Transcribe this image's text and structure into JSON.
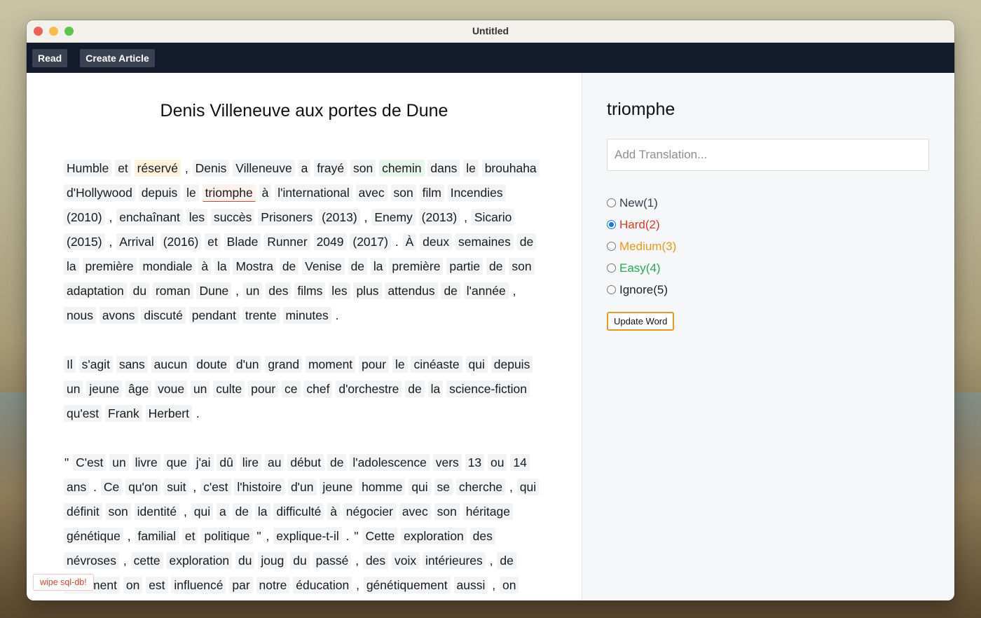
{
  "window": {
    "title": "Untitled"
  },
  "nav": {
    "read_label": "Read",
    "create_label": "Create Article"
  },
  "article": {
    "title": "Denis Villeneuve aux portes de Dune",
    "paragraphs": [
      [
        {
          "t": "Humble"
        },
        {
          "t": "et"
        },
        {
          "t": "réservé",
          "s": "medium"
        },
        {
          "t": ",",
          "p": true
        },
        {
          "t": "Denis"
        },
        {
          "t": "Villeneuve"
        },
        {
          "t": "a"
        },
        {
          "t": "frayé"
        },
        {
          "t": "son"
        },
        {
          "t": "chemin",
          "s": "easy"
        },
        {
          "t": "dans"
        },
        {
          "t": "le"
        },
        {
          "t": "brouhaha"
        },
        {
          "t": "d'Hollywood"
        },
        {
          "t": "depuis"
        },
        {
          "t": "le"
        },
        {
          "t": "triomphe",
          "s": "hard"
        },
        {
          "t": "à"
        },
        {
          "t": "l'international"
        },
        {
          "t": "avec"
        },
        {
          "t": "son"
        },
        {
          "t": "film"
        },
        {
          "t": "Incendies"
        },
        {
          "t": "(2010)"
        },
        {
          "t": ",",
          "p": true
        },
        {
          "t": "enchaînant"
        },
        {
          "t": "les"
        },
        {
          "t": "succès"
        },
        {
          "t": "Prisoners"
        },
        {
          "t": "(2013)"
        },
        {
          "t": ",",
          "p": true
        },
        {
          "t": "Enemy"
        },
        {
          "t": "(2013)"
        },
        {
          "t": ",",
          "p": true
        },
        {
          "t": "Sicario"
        },
        {
          "t": "(2015)"
        },
        {
          "t": ",",
          "p": true
        },
        {
          "t": "Arrival"
        },
        {
          "t": "(2016)"
        },
        {
          "t": "et"
        },
        {
          "t": "Blade"
        },
        {
          "t": "Runner"
        },
        {
          "t": "2049"
        },
        {
          "t": "(2017)"
        },
        {
          "t": ".",
          "p": true
        },
        {
          "t": "À"
        },
        {
          "t": "deux"
        },
        {
          "t": "semaines"
        },
        {
          "t": "de"
        },
        {
          "t": "la"
        },
        {
          "t": "première"
        },
        {
          "t": "mondiale"
        },
        {
          "t": "à"
        },
        {
          "t": "la"
        },
        {
          "t": "Mostra"
        },
        {
          "t": "de"
        },
        {
          "t": "Venise"
        },
        {
          "t": "de"
        },
        {
          "t": "la"
        },
        {
          "t": "première"
        },
        {
          "t": "partie"
        },
        {
          "t": "de"
        },
        {
          "t": "son"
        },
        {
          "t": "adaptation"
        },
        {
          "t": "du"
        },
        {
          "t": "roman"
        },
        {
          "t": "Dune"
        },
        {
          "t": ",",
          "p": true
        },
        {
          "t": "un"
        },
        {
          "t": "des"
        },
        {
          "t": "films"
        },
        {
          "t": "les"
        },
        {
          "t": "plus"
        },
        {
          "t": "attendus"
        },
        {
          "t": "de"
        },
        {
          "t": "l'année"
        },
        {
          "t": ",",
          "p": true
        },
        {
          "t": "nous"
        },
        {
          "t": "avons"
        },
        {
          "t": "discuté"
        },
        {
          "t": "pendant"
        },
        {
          "t": "trente"
        },
        {
          "t": "minutes"
        },
        {
          "t": ".",
          "p": true
        }
      ],
      [
        {
          "t": "Il"
        },
        {
          "t": "s'agit"
        },
        {
          "t": "sans"
        },
        {
          "t": "aucun"
        },
        {
          "t": "doute"
        },
        {
          "t": "d'un"
        },
        {
          "t": "grand"
        },
        {
          "t": "moment"
        },
        {
          "t": "pour"
        },
        {
          "t": "le"
        },
        {
          "t": "cinéaste"
        },
        {
          "t": "qui"
        },
        {
          "t": "depuis"
        },
        {
          "t": "un"
        },
        {
          "t": "jeune"
        },
        {
          "t": "âge"
        },
        {
          "t": "voue"
        },
        {
          "t": "un"
        },
        {
          "t": "culte"
        },
        {
          "t": "pour"
        },
        {
          "t": "ce"
        },
        {
          "t": "chef"
        },
        {
          "t": "d'orchestre"
        },
        {
          "t": "de"
        },
        {
          "t": "la"
        },
        {
          "t": "science-fiction"
        },
        {
          "t": "qu'est"
        },
        {
          "t": "Frank"
        },
        {
          "t": "Herbert"
        },
        {
          "t": ".",
          "p": true
        }
      ],
      [
        {
          "t": "\"",
          "p": true
        },
        {
          "t": "C'est"
        },
        {
          "t": "un"
        },
        {
          "t": "livre"
        },
        {
          "t": "que"
        },
        {
          "t": "j'ai"
        },
        {
          "t": "dû"
        },
        {
          "t": "lire"
        },
        {
          "t": "au"
        },
        {
          "t": "début"
        },
        {
          "t": "de"
        },
        {
          "t": "l'adolescence"
        },
        {
          "t": "vers"
        },
        {
          "t": "13"
        },
        {
          "t": "ou"
        },
        {
          "t": "14"
        },
        {
          "t": "ans"
        },
        {
          "t": ".",
          "p": true
        },
        {
          "t": "Ce"
        },
        {
          "t": "qu'on"
        },
        {
          "t": "suit"
        },
        {
          "t": ",",
          "p": true
        },
        {
          "t": "c'est"
        },
        {
          "t": "l'histoire"
        },
        {
          "t": "d'un"
        },
        {
          "t": "jeune"
        },
        {
          "t": "homme"
        },
        {
          "t": "qui"
        },
        {
          "t": "se"
        },
        {
          "t": "cherche"
        },
        {
          "t": ",",
          "p": true
        },
        {
          "t": "qui"
        },
        {
          "t": "définit"
        },
        {
          "t": "son"
        },
        {
          "t": "identité"
        },
        {
          "t": ",",
          "p": true
        },
        {
          "t": "qui"
        },
        {
          "t": "a"
        },
        {
          "t": "de"
        },
        {
          "t": "la"
        },
        {
          "t": "difficulté"
        },
        {
          "t": "à"
        },
        {
          "t": "négocier"
        },
        {
          "t": "avec"
        },
        {
          "t": "son"
        },
        {
          "t": "héritage"
        },
        {
          "t": "génétique"
        },
        {
          "t": ",",
          "p": true
        },
        {
          "t": "familial"
        },
        {
          "t": "et"
        },
        {
          "t": "politique"
        },
        {
          "t": "\"",
          "p": true
        },
        {
          "t": ",",
          "p": true
        },
        {
          "t": "explique-t-il"
        },
        {
          "t": ".",
          "p": true
        },
        {
          "t": "\"",
          "p": true
        },
        {
          "t": "Cette"
        },
        {
          "t": "exploration"
        },
        {
          "t": "des"
        },
        {
          "t": "névroses"
        },
        {
          "t": ",",
          "p": true
        },
        {
          "t": "cette"
        },
        {
          "t": "exploration"
        },
        {
          "t": "du"
        },
        {
          "t": "joug"
        },
        {
          "t": "du"
        },
        {
          "t": "passé"
        },
        {
          "t": ",",
          "p": true
        },
        {
          "t": "des"
        },
        {
          "t": "voix"
        },
        {
          "t": "intérieures"
        },
        {
          "t": ",",
          "p": true
        },
        {
          "t": "de"
        },
        {
          "t": "comment"
        },
        {
          "t": "on"
        },
        {
          "t": "est"
        },
        {
          "t": "influencé"
        },
        {
          "t": "par"
        },
        {
          "t": "notre"
        },
        {
          "t": "éducation"
        },
        {
          "t": ",",
          "p": true
        },
        {
          "t": "génétiquement"
        },
        {
          "t": "aussi"
        },
        {
          "t": ",",
          "p": true
        },
        {
          "t": "on"
        }
      ]
    ]
  },
  "debug": {
    "wipe_label": "wipe sql-db!"
  },
  "sidebar": {
    "selected_word": "triomphe",
    "translation_placeholder": "Add Translation...",
    "translation_value": "",
    "options": [
      {
        "label": "New(1)",
        "status": "new",
        "checked": false
      },
      {
        "label": "Hard(2)",
        "status": "hard",
        "checked": true
      },
      {
        "label": "Medium(3)",
        "status": "medium",
        "checked": false
      },
      {
        "label": "Easy(4)",
        "status": "easy",
        "checked": false
      },
      {
        "label": "Ignore(5)",
        "status": "ignore",
        "checked": false
      }
    ],
    "update_label": "Update Word"
  },
  "colors": {
    "navbar": "#121a2b",
    "hard": "#d93a2b",
    "medium": "#e59a1d",
    "easy": "#2aa55a",
    "radio_selected": "#1a73e8"
  }
}
